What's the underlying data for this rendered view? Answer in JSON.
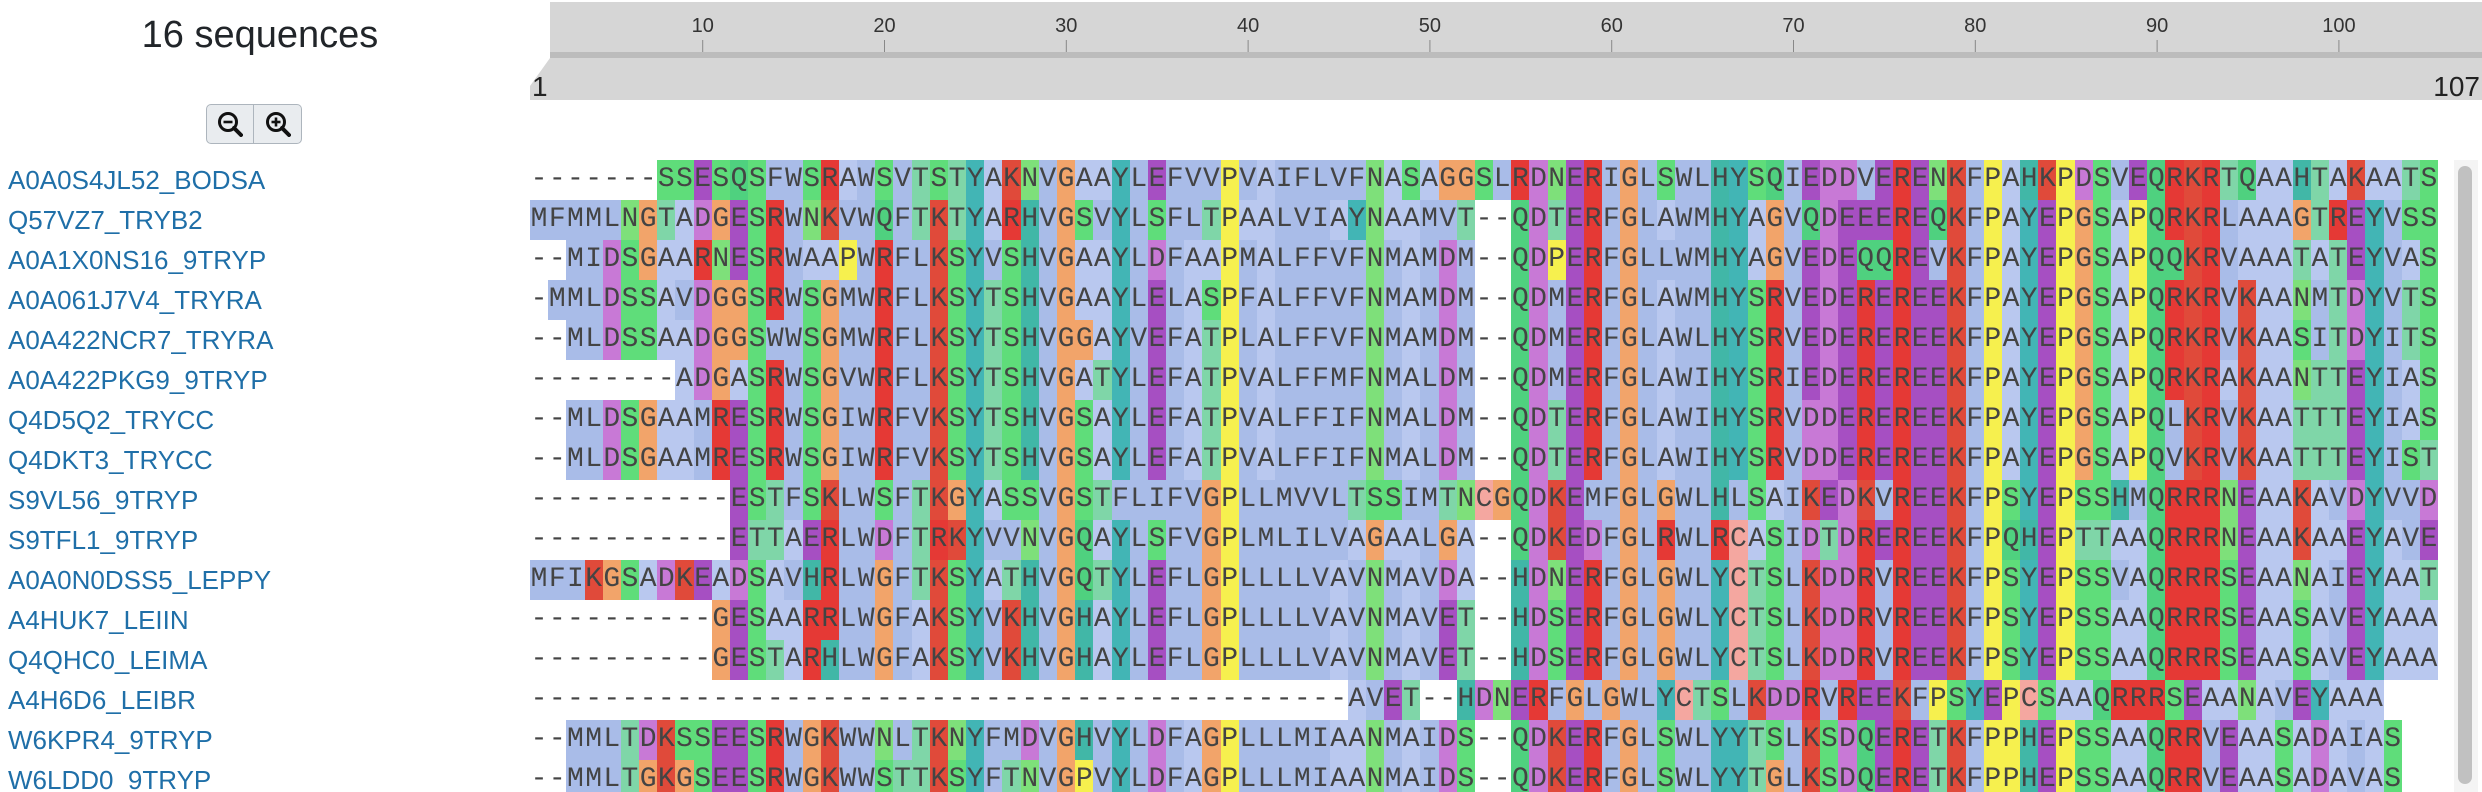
{
  "header": {
    "sequence_count": "16 sequences"
  },
  "zoom": {
    "out_icon": "zoom-out-icon",
    "in_icon": "zoom-in-icon"
  },
  "ruler": {
    "start": "1",
    "end": "107",
    "ticks": [
      "10",
      "20",
      "30",
      "40",
      "50",
      "60",
      "70",
      "80",
      "90",
      "100"
    ],
    "tick_positions": [
      10,
      20,
      30,
      40,
      50,
      60,
      70,
      80,
      90,
      100
    ]
  },
  "sequences": [
    {
      "name": "A0A0S4JL52_BODSA",
      "seq": "-------SSESQSFWSRAWSVTSTYAKNVGAAYLEFVVPVAIFLVFNASAGGSLRDNERIGLSWLHYSQIEDDVERENKFPAHKPDSVEQRKRTQAAHTAKAATS"
    },
    {
      "name": "Q57VZ7_TRYB2",
      "seq": "MFMMLNGTADGESRWNKVWQFTKTYARHVGSVYLSFLTPAALVIAYNAAMVT--QDTERFGLAWMHYAGVQDEEEREQKFPAYEPGSAPQRKRLAAAGTREYVSS"
    },
    {
      "name": "A0A1X0NS16_9TRYP",
      "seq": "--MIDSGAARNESRWAAPWRFLKSYVSHVGAAYLDFAAPMALFFVFNMAMDM--QDPERFGLLWMHYAGVEDEQQREVKFPAYEPGSAPQQKRVAAATATEYVAS"
    },
    {
      "name": "A0A061J7V4_TRYRA",
      "seq": "-MMLDSSAVDGGSRWSGMWRFLKSYTSHVGAAYLELASPFALFFVFNMAMDM--QDMERFGLAWMHYSRVEDEREREEKFPAYEPGSAPQRKRVKAANMTDYVTS"
    },
    {
      "name": "A0A422NCR7_TRYRA",
      "seq": "--MLDSSAADGGSWWSGMWRFLKSYTSHVGGAYVEFATPLALFFVFNMAMDM--QDMERFGLAWLHYSRVEDEREREEKFPAYEPGSAPQRKRVKAASITDYITS"
    },
    {
      "name": "A0A422PKG9_9TRYP",
      "seq": "--------ADGASRWSGVWRFLKSYTSHVGATYLEFATPVALFFMFNMALDM--QDMERFGLAWIHYSRIEDEREREEKFPAYEPGSAPQRKRAKAANTTEYIAS"
    },
    {
      "name": "Q4D5Q2_TRYCC",
      "seq": "--MLDSGAAMRESRWSGIWRFVKSYTSHVGSAYLEFATPVALFFIFNMALDM--QDTERFGLAWIHYSRVDDEREREEKFPAYEPGSAPQLKRVKAATTTEYIAS"
    },
    {
      "name": "Q4DKT3_TRYCC",
      "seq": "--MLDSGAAMRESRWSGIWRFVKSYTSHVGSAYLEFATPVALFFIFNMALDM--QDTERFGLAWIHYSRVDDEREREEKFPAYEPGSAPQVKRVKAATTTEYIST"
    },
    {
      "name": "S9VL56_9TRYP",
      "seq": "-----------ESTFSKLWSFTKGYASSVGSTFLIFVGPLLMVVLTSSIMTNCGQDKEMFGLGWLHLSAIKEDKVREEKFPSYEPSSHMQRRRNEAAKAVDYVVD"
    },
    {
      "name": "S9TFL1_9TRYP",
      "seq": "-----------ETTAERLWDFTRKYVVNVGQAYLSFVGPLMLILVAGAALGA--QDKEDFGLRWLRCASIDTDREREEKFPQHEPTTAAQRRRNEAAKAAEYAVE"
    },
    {
      "name": "A0A0N0DSS5_LEPPY",
      "seq": "MFIKGSADKEADSAVHRLWGFTKSYATHVGQTYLEFLGPLLLLVAVNMAVDA--HDNERFGLGWLYCTSLKDDRVREEKFPSYEPSSVAQRRRSEAANAIEYAAT"
    },
    {
      "name": "A4HUK7_LEIIN",
      "seq": "----------GESAARRLWGFAKSYVKHVGHAYLEFLGPLLLLVAVNMAVET--HDSERFGLGWLYCTSLKDDRVREEKFPSYEPSSAAQRRRSEAASAVEYAAA"
    },
    {
      "name": "Q4QHC0_LEIMA",
      "seq": "----------GESTARHLWGFAKSYVKHVGHAYLEFLGPLLLLVAVNMAVET--HDSERFGLGWLYCTSLKDDRVREEKFPSYEPSSAAQRRRSEAASAVEYAAA"
    },
    {
      "name": "A4H6D6_LEIBR",
      "seq": "---------------------------------------------AVET--HDNERFGLGWLYCTSLKDDRVREEKFPSYEPCSAAQRRRSEAANAVEYAAA"
    },
    {
      "name": "W6KPR4_9TRYP",
      "seq": "--MMLTDKSSEESRWGKWWNLTKNYFMDVGHVYLDFAGPLLLMIAANMAIDS--QDKERFGLSWLYYTSLKSDQERETKFPPHEPSSAAQRRVEAASADAIAS"
    },
    {
      "name": "W6LDD0_9TRYP",
      "seq": "--MMLTGKGSEESRWGKWWSTTKSYFTNVGPVYLDFAGPLLLMIAANMAIDS--QDKERFGLSWLYYTGLKSDQERETKFPPHEPSSAAQRRVEAASADAVAS"
    }
  ],
  "residue_colors": {
    "A": "#b9c8ef",
    "R": "#e53935",
    "K": "#e04a3a",
    "N": "#7ee07a",
    "D": "#c879d6",
    "C": "#f4a7a0",
    "Q": "#4fd17f",
    "E": "#a64fc2",
    "G": "#f2a46a",
    "H": "#41b7a7",
    "I": "#a9bce8",
    "L": "#a9bce8",
    "M": "#a9bce8",
    "F": "#a9bce8",
    "P": "#f6f04e",
    "S": "#5fdd7a",
    "T": "#7fd6a8",
    "W": "#a9bce8",
    "Y": "#42b5b5",
    "V": "#a9bce8",
    "-": "#ffffff"
  }
}
